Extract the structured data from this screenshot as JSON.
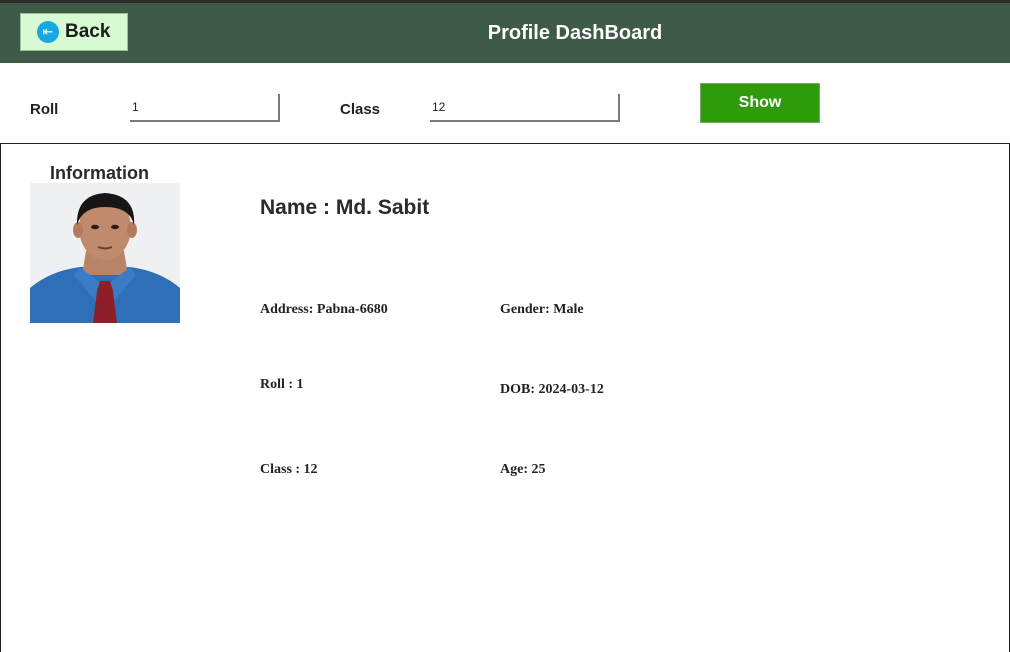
{
  "header": {
    "back_label": "Back",
    "back_icon": "back-arrow-icon",
    "title": "Profile DashBoard"
  },
  "search": {
    "roll_label": "Roll",
    "roll_value": "1",
    "class_label": "Class",
    "class_value": "12",
    "show_label": "Show"
  },
  "panel": {
    "heading": "Information",
    "name": "Name : Md. Sabit",
    "address": "Address: Pabna-6680",
    "gender": "Gender: Male",
    "roll": "Roll : 1",
    "dob": "DOB: 2024-03-12",
    "class": "Class : 12",
    "age": "Age: 25"
  },
  "colors": {
    "header_bg": "#3e5b4a",
    "back_bg": "#d6fbd2",
    "show_bg": "#2f9a0c",
    "back_icon_bg": "#1aa7e0"
  }
}
